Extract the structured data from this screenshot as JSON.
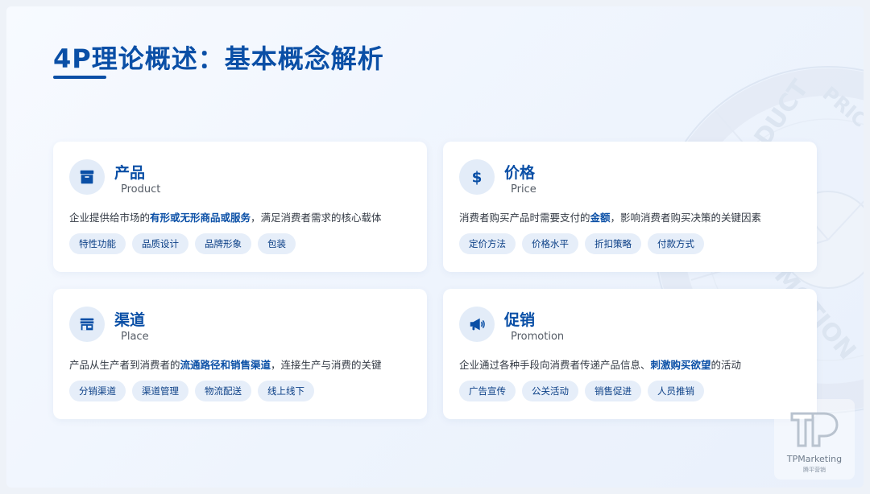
{
  "slide": {
    "title": "4P理论概述：基本概念解析"
  },
  "colors": {
    "accent": "#0a4fa6",
    "tag_bg": "#e6eef9",
    "icon_bg": "#e3ecf8"
  },
  "watermark": {
    "labels": [
      "PRODUCT",
      "PRIC",
      "PROMOTION"
    ]
  },
  "cards": [
    {
      "icon": "archive-box-icon",
      "title": "产品",
      "subtitle": "Product",
      "desc_before": "企业提供给市场的",
      "desc_highlight": "有形或无形商品或服务",
      "desc_after": "，满足消费者需求的核心载体",
      "tags": [
        "特性功能",
        "品质设计",
        "品牌形象",
        "包装"
      ]
    },
    {
      "icon": "dollar-icon",
      "title": "价格",
      "subtitle": "Price",
      "desc_before": "消费者购买产品时需要支付的",
      "desc_highlight": "金额",
      "desc_after": "，影响消费者购买决策的关键因素",
      "tags": [
        "定价方法",
        "价格水平",
        "折扣策略",
        "付款方式"
      ]
    },
    {
      "icon": "storefront-icon",
      "title": "渠道",
      "subtitle": "Place",
      "desc_before": "产品从生产者到消费者的",
      "desc_highlight": "流通路径和销售渠道",
      "desc_after": "，连接生产与消费的关键",
      "tags": [
        "分销渠道",
        "渠道管理",
        "物流配送",
        "线上线下"
      ]
    },
    {
      "icon": "megaphone-icon",
      "title": "促销",
      "subtitle": "Promotion",
      "desc_before": "企业通过各种手段向消费者传递产品信息、",
      "desc_highlight": "刺激购买欲望",
      "desc_after": "的活动",
      "tags": [
        "广告宣传",
        "公关活动",
        "销售促进",
        "人员推销"
      ]
    }
  ],
  "logo": {
    "name": "TPMarketing",
    "sub": "腾平营销"
  }
}
